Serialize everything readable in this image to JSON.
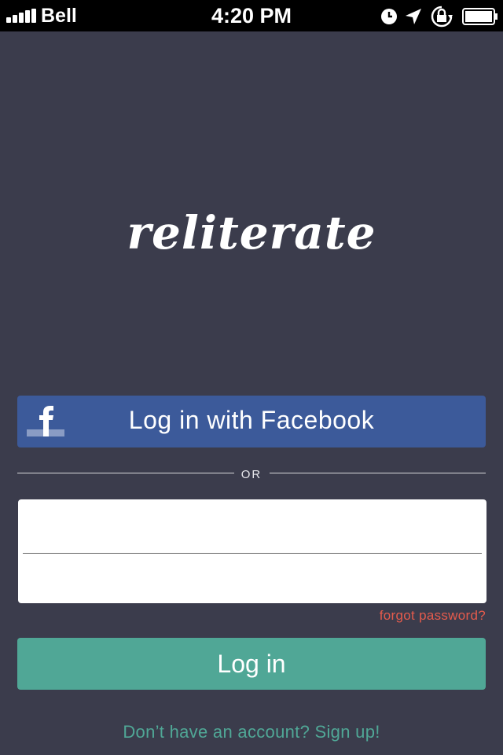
{
  "status_bar": {
    "carrier": "Bell",
    "time": "4:20 PM",
    "icons": [
      "signal-icon",
      "clock-icon",
      "location-arrow-icon",
      "orientation-lock-icon",
      "battery-icon"
    ]
  },
  "app": {
    "logo_text": "reliterate"
  },
  "facebook_button": {
    "label": "Log in with Facebook",
    "color": "#3c5a9a"
  },
  "divider": {
    "label": "OR"
  },
  "form": {
    "username_value": "",
    "username_placeholder": "",
    "password_value": "",
    "password_placeholder": ""
  },
  "forgot_password": {
    "label": "forgot password?",
    "color": "#e55b4c"
  },
  "login_button": {
    "label": "Log in",
    "color": "#50a796"
  },
  "signup_link": {
    "label": "Don’t have an account? Sign up!"
  },
  "colors": {
    "background": "#3b3c4c",
    "accent": "#50a796"
  }
}
